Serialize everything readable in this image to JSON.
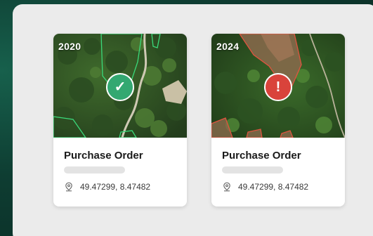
{
  "cards": [
    {
      "year": "2020",
      "status": "approved",
      "status_icon": "check-icon",
      "status_glyph": "✓",
      "status_color": "#33a871",
      "title": "Purchase Order",
      "location_icon": "map-pin-icon",
      "coordinates": "49.47299, 8.47482"
    },
    {
      "year": "2024",
      "status": "alert",
      "status_icon": "exclamation-icon",
      "status_glyph": "!",
      "status_color": "#d9433b",
      "title": "Purchase Order",
      "location_icon": "map-pin-icon",
      "coordinates": "49.47299, 8.47482"
    }
  ],
  "colors": {
    "background": "#0e3d32",
    "panel": "#ebebeb",
    "parcel_ok": "#3ad97a",
    "parcel_alert": "#e0533f"
  }
}
